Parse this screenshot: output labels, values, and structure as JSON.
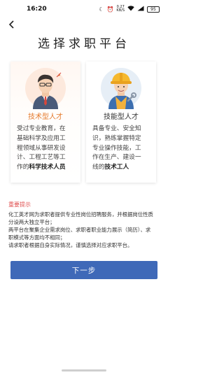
{
  "status_bar": {
    "time": "16:20",
    "speed_value": "0.27",
    "speed_unit": "KB/S",
    "battery": "95"
  },
  "header": {
    "title": "选择求职平台"
  },
  "cards": [
    {
      "label": "技术型人才",
      "desc_lines": [
        "受过专业教育，在",
        "基础科学及应用工",
        "程领域从事研发设",
        "计、工程工艺等工",
        "作的"
      ],
      "desc_bold": "科学技术人员",
      "avatar": "professional-avatar-icon",
      "accent": "#e57a2c"
    },
    {
      "label": "技能型人才",
      "desc_lines": [
        "具备专业、安全知",
        "识，熟练掌握特定",
        "专业操作技能，工",
        "作在生产、建设一",
        "线的"
      ],
      "desc_bold": "技术工人",
      "avatar": "worker-avatar-icon",
      "accent": "#333333"
    }
  ],
  "notice": {
    "heading": "重要提示",
    "lines": [
      "化工英才网为求职者提供专业性岗位招聘服务，并根据岗位性质",
      "分设两大独立平台；",
      "两平台在聚集企业需求岗位、求职者职业能力展示（简历）、求",
      "职模式等方面均不相同；",
      "请求职者根据自身实际情况，谨慎选择对应求职平台。"
    ],
    "heading_color": "#e05050"
  },
  "actions": {
    "next_label": "下一步",
    "button_color": "#3f69b8"
  }
}
